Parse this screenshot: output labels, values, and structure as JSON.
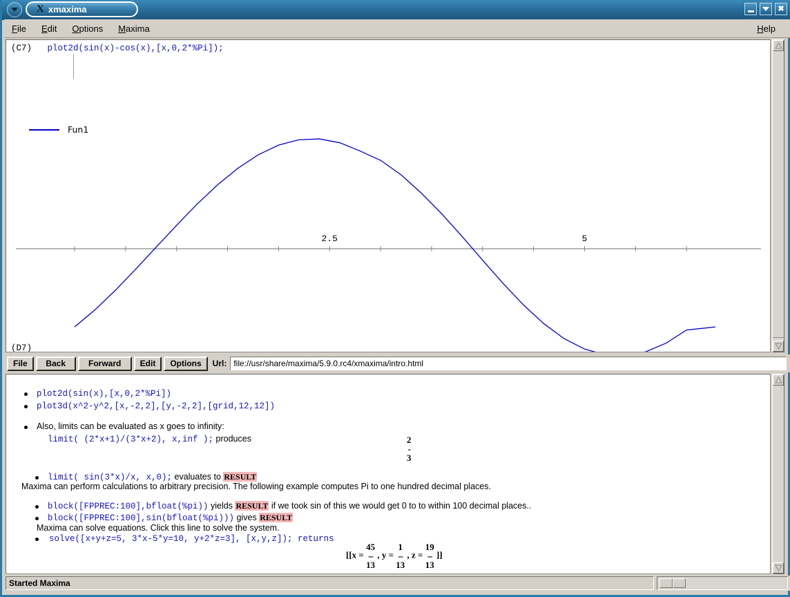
{
  "window": {
    "title": "xmaxima",
    "app_glyph": "X",
    "buttons": {
      "minimize": "_",
      "maximize": "▾",
      "close": "✕"
    }
  },
  "menubar": {
    "items": [
      {
        "label": "File",
        "mnemonic": "F"
      },
      {
        "label": "Edit",
        "mnemonic": "E"
      },
      {
        "label": "Options",
        "mnemonic": "O"
      },
      {
        "label": "Maxima",
        "mnemonic": "M"
      }
    ],
    "help": {
      "label": "Help",
      "mnemonic": "H"
    }
  },
  "console": {
    "prompt_label": "(C7)",
    "prompt_code": "plot2d(sin(x)-cos(x),[x,0,2*%Pi]);",
    "next_prompt": "(D7)",
    "legend_label": "Fun1",
    "legend_color": "#0000cc"
  },
  "chart_data": {
    "type": "line",
    "title": "",
    "expression": "sin(x)-cos(x)",
    "xlabel": "",
    "ylabel": "",
    "xlim": [
      0,
      6.2831853
    ],
    "ylim": [
      -1.4142136,
      1.4142136
    ],
    "grid": false,
    "legend_position": "top-left",
    "series": [
      {
        "name": "Fun1",
        "color": "#0000cc",
        "x": [
          0,
          0.2,
          0.4,
          0.6,
          0.8,
          1.0,
          1.2,
          1.4,
          1.6,
          1.8,
          2.0,
          2.2,
          2.4,
          2.6,
          2.8,
          3.0,
          3.2,
          3.4,
          3.6,
          3.8,
          4.0,
          4.2,
          4.4,
          4.6,
          4.8,
          5.0,
          5.2,
          5.4,
          5.6,
          5.8,
          6.0,
          6.2831853
        ],
        "y": [
          -1.0,
          -0.7815,
          -0.5316,
          -0.2605,
          0.0202,
          0.2999,
          0.5697,
          0.8152,
          1.0288,
          1.2016,
          1.3254,
          1.3943,
          1.4049,
          1.3562,
          1.2503,
          1.1311,
          0.9473,
          0.7118,
          0.4472,
          0.156,
          -0.1455,
          -0.4418,
          -0.7173,
          -0.9575,
          -1.15,
          -1.283,
          -1.355,
          -1.368,
          -1.3183,
          -1.2073,
          -1.0397,
          -1.0
        ]
      }
    ],
    "xticks_labeled": [
      {
        "value": 2.5,
        "label": "2.5"
      },
      {
        "value": 5,
        "label": "5"
      }
    ],
    "xticks_minor_step": 0.5,
    "axis_color": "#8a8a8a"
  },
  "browser_toolbar": {
    "file_label": "File",
    "back_label": "Back",
    "forward_label": "Forward",
    "edit_label": "Edit",
    "options_label": "Options",
    "url_label": "Url:",
    "url_value": "file://usr/share/maxima/5.9.0.rc4/xmaxima/intro.html"
  },
  "help_content": {
    "items": [
      {
        "kind": "code-bullet",
        "code": "plot2d(sin(x),[x,0,2*%Pi])"
      },
      {
        "kind": "code-bullet",
        "code": "plot3d(x^2-y^2,[x,-2,2],[y,-2,2],[grid,12,12])"
      },
      {
        "kind": "text-bullet",
        "text": "Also, limits can be evaluated as x goes to infinity:"
      },
      {
        "kind": "code-cont",
        "code": "limit( (2*x+1)/(3*x+2),   x,inf );",
        "tail": " produces"
      },
      {
        "kind": "fraction",
        "numerator": "2",
        "denominator": "3"
      },
      {
        "kind": "code-bullet-result",
        "code": "limit( sin(3*x)/x,   x,0);",
        "mid": " evaluates to ",
        "result": "RESULT"
      },
      {
        "kind": "text",
        "text": "Maxima can perform calculations to arbitrary precision. The following example computes Pi to one hundred decimal places."
      },
      {
        "kind": "code-bullet-result-tail",
        "code": "block([FPPREC:100],bfloat(%pi))",
        "mid": " yields ",
        "result": "RESULT",
        "tail": " if we took sin of this we would get 0 to to within 100 decimal places.."
      },
      {
        "kind": "code-bullet-result",
        "code": "block([FPPREC:100],sin(bfloat(%pi)))",
        "mid": " gives ",
        "result": "RESULT"
      },
      {
        "kind": "text-indent",
        "text": "Maxima can solve equations. Click this line to solve the system."
      },
      {
        "kind": "code-bullet",
        "code": "solve([x+y+z=5, 3*x-5*y=10, y+2*z=3], [x,y,z]); returns"
      }
    ],
    "solve_result": {
      "open": "[[x  =",
      "x_num": "45",
      "x_den": "13",
      "y_lead": ",  y  =",
      "y_num": "1",
      "y_den": "13",
      "z_lead": ",  z  =",
      "z_num": "19",
      "z_den": "13",
      "close": "]]"
    }
  },
  "statusbar": {
    "message": "Started Maxima"
  }
}
